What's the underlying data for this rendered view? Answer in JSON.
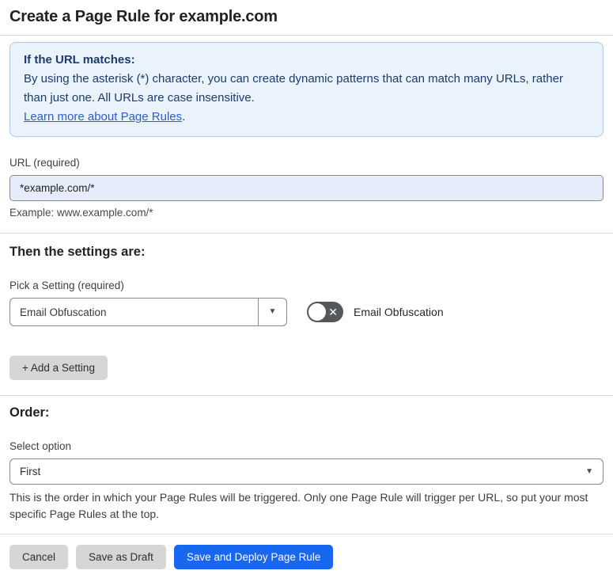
{
  "page": {
    "title": "Create a Page Rule for example.com"
  },
  "info_box": {
    "heading": "If the URL matches:",
    "body": "By using the asterisk (*) character, you can create dynamic patterns that can match many URLs, rather than just one. All URLs are case insensitive.",
    "link_text": "Learn more about Page Rules",
    "link_suffix": "."
  },
  "url_field": {
    "label": "URL (required)",
    "value": "*example.com/*",
    "example": "Example: www.example.com/*"
  },
  "settings_section": {
    "heading": "Then the settings are:",
    "picker_label": "Pick a Setting (required)",
    "picker_value": "Email Obfuscation",
    "picker_caret": "▼",
    "toggle_state": "off",
    "toggle_off_glyph": "✕",
    "toggle_label": "Email Obfuscation",
    "add_button_label": "+ Add a Setting"
  },
  "order_section": {
    "heading": "Order:",
    "select_label": "Select option",
    "select_value": "First",
    "select_caret": "▼",
    "help": "This is the order in which your Page Rules will be triggered. Only one Page Rule will trigger per URL, so put your most specific Page Rules at the top."
  },
  "footer": {
    "cancel_label": "Cancel",
    "save_draft_label": "Save as Draft",
    "save_deploy_label": "Save and Deploy Page Rule"
  },
  "colors": {
    "info_bg": "#eaf3fc",
    "info_border": "#a9c9e6",
    "info_text": "#1d3b6f",
    "link_blue": "#2c5ecf",
    "input_autofill_bg": "#e7ecfa",
    "toggle_off_bg": "#54585b",
    "primary_button_bg": "#1767f0",
    "gray_button_bg": "#d6d6d6"
  }
}
